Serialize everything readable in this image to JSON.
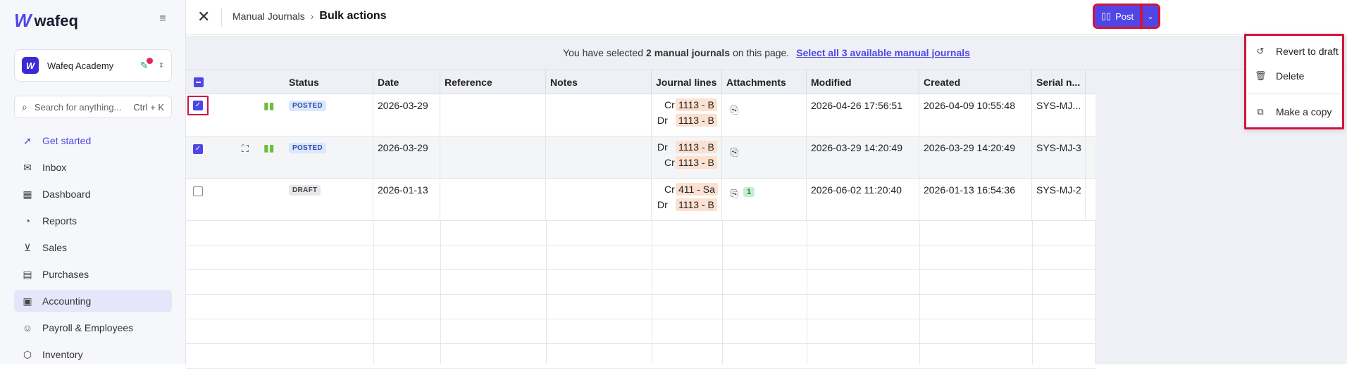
{
  "sidebar": {
    "logo_text": "wafeq",
    "org_name": "Wafeq Academy",
    "search_placeholder": "Search for anything...",
    "search_shortcut": "Ctrl + K",
    "items": [
      {
        "label": "Get started",
        "icon": "rocket-icon"
      },
      {
        "label": "Inbox",
        "icon": "inbox-icon"
      },
      {
        "label": "Dashboard",
        "icon": "dashboard-icon"
      },
      {
        "label": "Reports",
        "icon": "reports-icon"
      },
      {
        "label": "Sales",
        "icon": "cart-icon"
      },
      {
        "label": "Purchases",
        "icon": "receipt-icon"
      },
      {
        "label": "Accounting",
        "icon": "accounting-icon"
      },
      {
        "label": "Payroll & Employees",
        "icon": "people-icon"
      },
      {
        "label": "Inventory",
        "icon": "box-icon"
      }
    ]
  },
  "header": {
    "breadcrumb_parent": "Manual Journals",
    "breadcrumb_separator": "›",
    "title": "Bulk actions",
    "post_label": "Post"
  },
  "banner": {
    "prefix": "You have selected",
    "count_text": "2 manual journals",
    "suffix": "on this page.",
    "select_all": "Select all 3 available manual journals"
  },
  "table": {
    "columns": [
      "Status",
      "Date",
      "Reference",
      "Notes",
      "Journal lines",
      "Attachments",
      "Modified",
      "Created",
      "Serial n..."
    ],
    "rows": [
      {
        "status": "POSTED",
        "date": "2026-03-29",
        "reference": "",
        "notes": "",
        "lines": [
          {
            "dc": "Cr",
            "acct": "1113 - B"
          },
          {
            "dc": "Dr",
            "acct": "1113 - B"
          }
        ],
        "attachments_count": "",
        "modified": "2026-04-26 17:56:51",
        "created": "2026-04-09 10:55:48",
        "serial": "SYS-MJ...",
        "checked": true
      },
      {
        "status": "POSTED",
        "date": "2026-03-29",
        "reference": "",
        "notes": "",
        "lines": [
          {
            "dc": "Dr",
            "acct": "1113 - B"
          },
          {
            "dc": "Cr",
            "acct": "1113 - B"
          }
        ],
        "attachments_count": "",
        "modified": "2026-03-29 14:20:49",
        "created": "2026-03-29 14:20:49",
        "serial": "SYS-MJ-3",
        "checked": true
      },
      {
        "status": "DRAFT",
        "date": "2026-01-13",
        "reference": "",
        "notes": "",
        "lines": [
          {
            "dc": "Cr",
            "acct": "411 - Sa"
          },
          {
            "dc": "Dr",
            "acct": "1113 - B"
          }
        ],
        "attachments_count": "1",
        "modified": "2026-06-02 11:20:40",
        "created": "2026-01-13 16:54:36",
        "serial": "SYS-MJ-2",
        "checked": false
      }
    ]
  },
  "menu": {
    "items": [
      "Revert to draft",
      "Delete",
      "Make a copy"
    ]
  },
  "colors": {
    "accent": "#4f46e5",
    "highlight": "#d1143d",
    "posted_badge": "#dbe7fb",
    "account_chip": "#fde1d0"
  }
}
